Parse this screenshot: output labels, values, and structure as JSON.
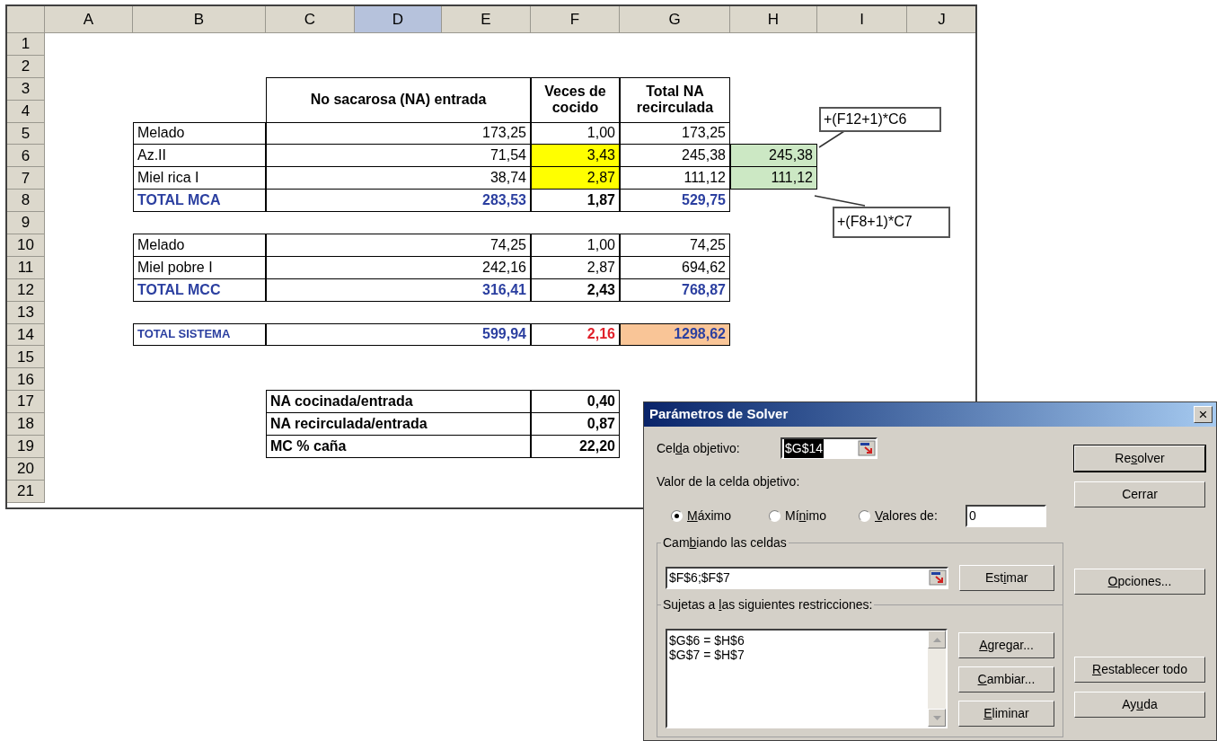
{
  "sheet": {
    "columns": [
      {
        "label": "A",
        "selected": false
      },
      {
        "label": "B",
        "selected": false
      },
      {
        "label": "C",
        "selected": false
      },
      {
        "label": "D",
        "selected": true
      },
      {
        "label": "E",
        "selected": false
      },
      {
        "label": "F",
        "selected": false
      },
      {
        "label": "G",
        "selected": false
      },
      {
        "label": "H",
        "selected": false
      },
      {
        "label": "I",
        "selected": false
      },
      {
        "label": "J",
        "selected": false
      }
    ],
    "rows": [
      {
        "number": "1",
        "cells": []
      },
      {
        "number": "2",
        "cells": []
      },
      {
        "number": "3",
        "cells": [
          {
            "kind": "blank"
          },
          {
            "kind": "head-amount",
            "text": "No sacarosa (NA) entrada",
            "bold": true,
            "variable": false,
            "objective": false
          },
          {
            "kind": "head-times",
            "text": "Veces de cocido",
            "bold": true,
            "variable": false,
            "objective": false
          },
          {
            "kind": "head-total",
            "text": "Total NA recirculada",
            "bold": true,
            "variable": false,
            "objective": false
          }
        ]
      },
      {
        "number": "4",
        "cells": []
      },
      {
        "number": "5",
        "cells": [
          {
            "kind": "name",
            "text": "Melado",
            "bold": false,
            "variable": false,
            "objective": false
          },
          {
            "kind": "amount",
            "text": "173,25",
            "bold": false,
            "variable": false,
            "objective": false
          },
          {
            "kind": "times",
            "text": "1,00",
            "bold": false,
            "variable": false,
            "objective": false
          },
          {
            "kind": "total",
            "text": "173,25",
            "bold": false,
            "variable": false,
            "objective": false
          }
        ]
      },
      {
        "number": "6",
        "cells": [
          {
            "kind": "name",
            "text": "Az.II",
            "bold": false,
            "variable": false,
            "objective": false
          },
          {
            "kind": "amount",
            "text": "71,54",
            "bold": false,
            "variable": false,
            "objective": false
          },
          {
            "kind": "times",
            "text": "3,43",
            "bold": false,
            "variable": true,
            "objective": false
          },
          {
            "kind": "total",
            "text": "245,38",
            "bold": false,
            "variable": false,
            "objective": false
          },
          {
            "kind": "check",
            "text": "245,38",
            "bold": false,
            "variable": false,
            "objective": false
          }
        ]
      },
      {
        "number": "7",
        "cells": [
          {
            "kind": "name",
            "text": "Miel rica I",
            "bold": false,
            "variable": false,
            "objective": false
          },
          {
            "kind": "amount",
            "text": "38,74",
            "bold": false,
            "variable": false,
            "objective": false
          },
          {
            "kind": "times",
            "text": "2,87",
            "bold": false,
            "variable": true,
            "objective": false
          },
          {
            "kind": "total",
            "text": "111,12",
            "bold": false,
            "variable": false,
            "objective": false
          },
          {
            "kind": "check",
            "text": "111,12",
            "bold": false,
            "variable": false,
            "objective": false
          }
        ]
      },
      {
        "number": "8",
        "cells": [
          {
            "kind": "name",
            "text": "TOTAL MCA",
            "bold": true,
            "color": "#2b3fa0",
            "variable": false,
            "objective": false
          },
          {
            "kind": "amount",
            "text": "283,53",
            "bold": true,
            "color": "#2b3fa0",
            "variable": false,
            "objective": false
          },
          {
            "kind": "times",
            "text": "1,87",
            "bold": true,
            "variable": false,
            "objective": false
          },
          {
            "kind": "total",
            "text": "529,75",
            "bold": true,
            "color": "#2b3fa0",
            "variable": false,
            "objective": false
          }
        ]
      },
      {
        "number": "9",
        "cells": []
      },
      {
        "number": "10",
        "cells": [
          {
            "kind": "name",
            "text": "Melado",
            "bold": false,
            "variable": false,
            "objective": false
          },
          {
            "kind": "amount",
            "text": "74,25",
            "bold": false,
            "variable": false,
            "objective": false
          },
          {
            "kind": "times",
            "text": "1,00",
            "bold": false,
            "variable": false,
            "objective": false
          },
          {
            "kind": "total",
            "text": "74,25",
            "bold": false,
            "variable": false,
            "objective": false
          }
        ]
      },
      {
        "number": "11",
        "cells": [
          {
            "kind": "name",
            "text": "Miel pobre I",
            "bold": false,
            "variable": false,
            "objective": false
          },
          {
            "kind": "amount",
            "text": "242,16",
            "bold": false,
            "variable": false,
            "objective": false
          },
          {
            "kind": "times",
            "text": "2,87",
            "bold": false,
            "variable": false,
            "objective": false
          },
          {
            "kind": "total",
            "text": "694,62",
            "bold": false,
            "variable": false,
            "objective": false
          }
        ]
      },
      {
        "number": "12",
        "cells": [
          {
            "kind": "name",
            "text": "TOTAL MCC",
            "bold": true,
            "color": "#2b3fa0",
            "variable": false,
            "objective": false
          },
          {
            "kind": "amount",
            "text": "316,41",
            "bold": true,
            "color": "#2b3fa0",
            "variable": false,
            "objective": false
          },
          {
            "kind": "times",
            "text": "2,43",
            "bold": true,
            "variable": false,
            "objective": false
          },
          {
            "kind": "total",
            "text": "768,87",
            "bold": true,
            "color": "#2b3fa0",
            "variable": false,
            "objective": false
          }
        ]
      },
      {
        "number": "13",
        "cells": []
      },
      {
        "number": "14",
        "cells": [
          {
            "kind": "name-small",
            "text": "TOTAL SISTEMA",
            "bold": true,
            "color": "#2b3fa0",
            "variable": false,
            "objective": false
          },
          {
            "kind": "amount",
            "text": "599,94",
            "bold": true,
            "color": "#2b3fa0",
            "variable": false,
            "objective": false
          },
          {
            "kind": "times",
            "text": "2,16",
            "bold": true,
            "color": "#e0202a",
            "variable": false,
            "objective": false
          },
          {
            "kind": "total",
            "text": "1298,62",
            "bold": true,
            "color": "#2b3fa0",
            "variable": false,
            "objective": true
          }
        ]
      },
      {
        "number": "15",
        "cells": []
      },
      {
        "number": "16",
        "cells": []
      },
      {
        "number": "17",
        "cells": [
          {
            "kind": "blank"
          },
          {
            "kind": "ratio-label",
            "text": "NA cocinada/entrada",
            "bold": true,
            "variable": false,
            "objective": false
          },
          {
            "kind": "times",
            "text": "0,40",
            "bold": true,
            "variable": false,
            "objective": false
          }
        ]
      },
      {
        "number": "18",
        "cells": [
          {
            "kind": "blank"
          },
          {
            "kind": "ratio-label",
            "text": "NA recirculada/entrada",
            "bold": true,
            "variable": false,
            "objective": false
          },
          {
            "kind": "times",
            "text": "0,87",
            "bold": true,
            "variable": false,
            "objective": false
          }
        ]
      },
      {
        "number": "19",
        "cells": [
          {
            "kind": "blank"
          },
          {
            "kind": "ratio-label",
            "text": "MC % caña",
            "bold": true,
            "variable": false,
            "objective": false
          },
          {
            "kind": "times",
            "text": "22,20",
            "bold": true,
            "variable": false,
            "objective": false
          }
        ]
      },
      {
        "number": "20",
        "cells": []
      },
      {
        "number": "21",
        "cells": []
      }
    ],
    "notes": [
      {
        "text": "+(F12+1)*C6"
      },
      {
        "text": "+(F8+1)*C7"
      }
    ]
  },
  "dialog": {
    "title": "Parámetros de Solver",
    "close": "×",
    "target": {
      "label": {
        "before": "Cel",
        "key": "d",
        "after": "a objetivo:"
      },
      "value": "$G$14"
    },
    "value_label": "Valor de la celda objetivo:",
    "options": [
      {
        "label": {
          "key": "M",
          "after": "áximo"
        },
        "selected": true
      },
      {
        "label": {
          "before": "Mí",
          "key": "n",
          "after": "imo"
        },
        "selected": false
      },
      {
        "label": {
          "key": "V",
          "after": "alores de:"
        },
        "selected": false
      }
    ],
    "value_field": "0",
    "changing": {
      "label": {
        "before": "Cam",
        "key": "b",
        "after": "iando las celdas"
      },
      "value": "$F$6;$F$7",
      "button": {
        "before": "Est",
        "key": "i",
        "after": "mar"
      }
    },
    "constraints": {
      "label": {
        "before": "Sujetas a ",
        "key": "l",
        "after": "as siguientes restricciones:"
      },
      "items": [
        "$G$6 = $H$6",
        "$G$7 = $H$7"
      ],
      "buttons": [
        {
          "key": "A",
          "after": "gregar..."
        },
        {
          "key": "C",
          "after": "ambiar..."
        },
        {
          "key": "E",
          "after": "liminar"
        }
      ]
    },
    "side_buttons": [
      {
        "label": {
          "before": "Re",
          "key": "s",
          "after": "olver"
        },
        "default": true
      },
      {
        "label": {
          "before": "Cerrar"
        },
        "default": false
      },
      {
        "label": {
          "key": "O",
          "after": "pciones..."
        },
        "default": false
      },
      {
        "label": {
          "key": "R",
          "after": "establecer todo"
        },
        "default": false
      },
      {
        "label": {
          "before": "Ay",
          "key": "u",
          "after": "da"
        },
        "default": false
      }
    ]
  }
}
